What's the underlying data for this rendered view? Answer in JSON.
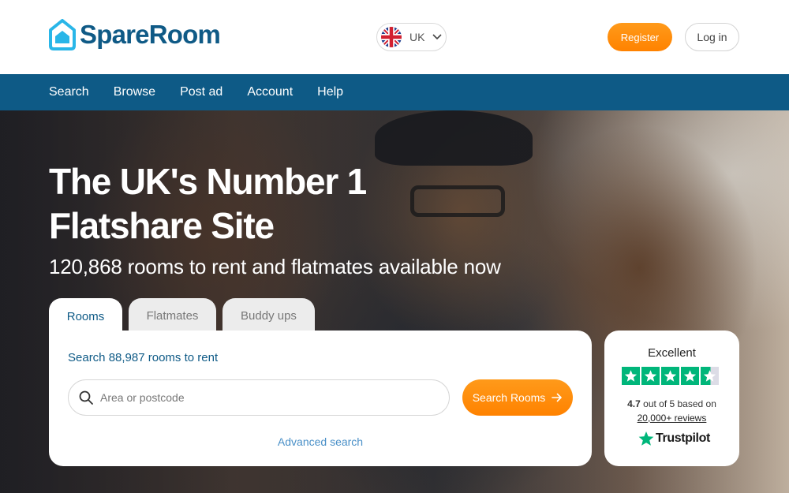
{
  "header": {
    "logo_text": "SpareRoom",
    "language": "UK",
    "register_label": "Register",
    "login_label": "Log in"
  },
  "nav": {
    "items": [
      {
        "label": "Search"
      },
      {
        "label": "Browse"
      },
      {
        "label": "Post ad"
      },
      {
        "label": "Account"
      },
      {
        "label": "Help"
      }
    ]
  },
  "hero": {
    "title_line1": "The UK's Number 1",
    "title_line2": "Flatshare Site",
    "subtitle": "120,868 rooms to rent and flatmates available now"
  },
  "tabs": [
    {
      "label": "Rooms",
      "active": true
    },
    {
      "label": "Flatmates",
      "active": false
    },
    {
      "label": "Buddy ups",
      "active": false
    }
  ],
  "search": {
    "title": "Search 88,987 rooms to rent",
    "placeholder": "Area or postcode",
    "button_label": "Search Rooms",
    "advanced_label": "Advanced search"
  },
  "trustpilot": {
    "heading": "Excellent",
    "rating_value": "4.7",
    "rating_suffix": "out of 5 based on",
    "reviews_label": "20,000+ reviews",
    "brand": "Trustpilot",
    "stars": 4.5
  },
  "colors": {
    "brand_blue": "#0e5a86",
    "accent_orange": "#ff8a00",
    "trustpilot_green": "#00b67a"
  },
  "icons": [
    "spareroom-logo-icon",
    "uk-flag-icon",
    "chevron-down-icon",
    "search-icon",
    "arrow-right-icon",
    "star-icon",
    "trustpilot-star-icon"
  ]
}
